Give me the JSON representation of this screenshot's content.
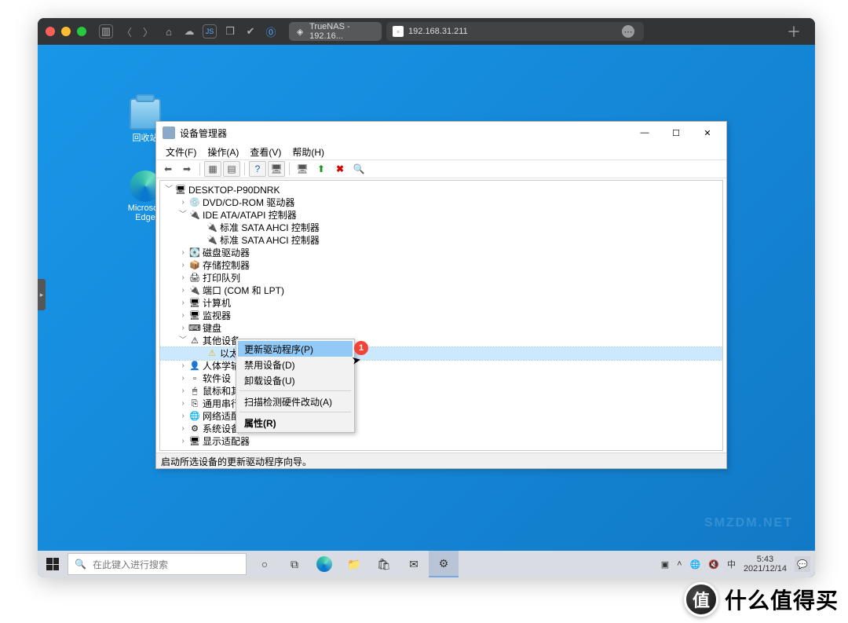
{
  "mac": {
    "tabs": [
      {
        "label": "TrueNAS - 192.16..."
      },
      {
        "label": "192.168.31.211"
      }
    ]
  },
  "desktop": {
    "recycle": "回收站",
    "edge": "Microsoft Edge"
  },
  "devmgr": {
    "title": "设备管理器",
    "menu": {
      "file": "文件(F)",
      "action": "操作(A)",
      "view": "查看(V)",
      "help": "帮助(H)"
    },
    "status": "启动所选设备的更新驱动程序向导。",
    "root": "DESKTOP-P90DNRK",
    "items": {
      "dvd": "DVD/CD-ROM 驱动器",
      "ide": "IDE ATA/ATAPI 控制器",
      "ahci1": "标准 SATA AHCI 控制器",
      "ahci2": "标准 SATA AHCI 控制器",
      "disk": "磁盘驱动器",
      "storage": "存储控制器",
      "print": "打印队列",
      "ports": "端口 (COM 和 LPT)",
      "computer": "计算机",
      "monitor": "监视器",
      "keyboard": "键盘",
      "other": "其他设备",
      "eth": "以太网控制器",
      "hid": "人体学输",
      "soft": "软件设",
      "mouse": "鼠标和其",
      "usb": "通用串行",
      "net": "网络适配",
      "sysdev": "系统设备",
      "display": "显示适配器"
    }
  },
  "ctx": {
    "update": "更新驱动程序(P)",
    "disable": "禁用设备(D)",
    "uninstall": "卸载设备(U)",
    "scan": "扫描检测硬件改动(A)",
    "prop": "属性(R)",
    "badge": "1"
  },
  "taskbar": {
    "search": "在此键入进行搜索",
    "ime": "中",
    "time": "5:43",
    "date": "2021/12/14"
  },
  "watermark": {
    "logo": "值",
    "text": "什么值得买",
    "faint": "SMZDM.NET"
  }
}
